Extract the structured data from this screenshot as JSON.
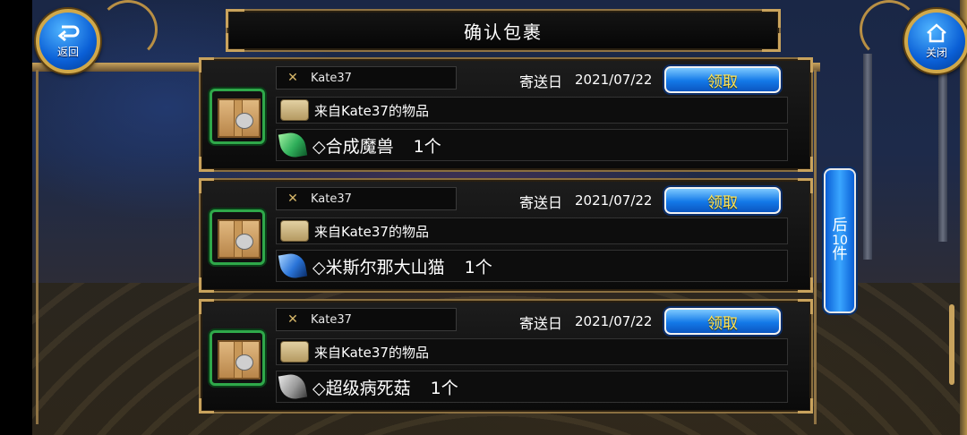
{
  "header": {
    "title": "确认包裹"
  },
  "back_button": {
    "label": "返回",
    "icon": "return-arrow-icon"
  },
  "close_button": {
    "label": "关闭",
    "icon": "home-icon"
  },
  "parcels": [
    {
      "sender": "Kate37",
      "date_label": "寄送日",
      "date": "2021/07/22",
      "claim_label": "领取",
      "from_text": "来自Kate37的物品",
      "item_name": "◇合成魔兽",
      "quantity": "1个",
      "item_color": "#2fae5a"
    },
    {
      "sender": "Kate37",
      "date_label": "寄送日",
      "date": "2021/07/22",
      "claim_label": "领取",
      "from_text": "来自Kate37的物品",
      "item_name": "◇米斯尔那大山猫",
      "quantity": "1个",
      "item_color": "#2a74d8"
    },
    {
      "sender": "Kate37",
      "date_label": "寄送日",
      "date": "2021/07/22",
      "claim_label": "领取",
      "from_text": "来自Kate37的物品",
      "item_name": "◇超级病死菇",
      "quantity": "1个",
      "item_color": "#9a9a9a"
    }
  ],
  "next_button": {
    "line1": "后",
    "line2": "10",
    "line3": "件"
  },
  "colors": {
    "accent_gold": "#c9a35d",
    "button_blue": "#1379e8",
    "claim_text": "#ffe45a"
  }
}
